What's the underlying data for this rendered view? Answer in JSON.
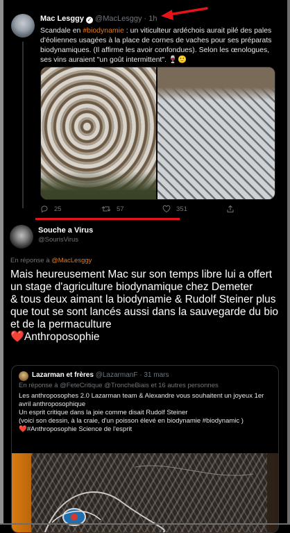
{
  "colors": {
    "accent": "#e07a19",
    "annotation_red": "#e6141a",
    "heart": "#e8245a"
  },
  "tweet1": {
    "name": "Mac Lesggy",
    "handle": "@MacLesggy",
    "time": "1h",
    "text_1": "Scandale en ",
    "hashtag": "#biodynamie",
    "text_2": " : un viticulteur ardéchois aurait pilé des pales d'éoliennes usagées à la place de cornes de vaches pour ses préparats biodynamiques.  (Il affirme les avoir confondues). Selon les œnologues, ses vins auraient \"un goût intermittent\". 🍷🙂",
    "replies": "25",
    "retweets": "57",
    "likes": "351"
  },
  "tweet2": {
    "name": "Souche a Virus",
    "handle": "@SourisVirus",
    "reply_prefix": "En réponse à ",
    "reply_to": "@MacLesggy",
    "text": "Mais heureusement Mac sur son temps libre lui a offert un stage d'agriculture biodynamique chez Demeter\n& tous deux aimant la biodynamie & Rudolf Steiner plus que tout se sont lancés aussi dans la sauvegarde du bio et de la permaculture",
    "heart": "❤️",
    "tag_line": "Anthroposophie"
  },
  "quote": {
    "name": "Lazarman et frères",
    "handle": "@LazarmanF",
    "date": "· 31 mars",
    "reply_line": "En réponse à @FeteCritique @TroncheBiais et 16 autres personnes",
    "text": "Les anthroposophes 2.0 Lazarman team & Alexandre vous souhaitent un joyeux 1er avril anthroposophique\nUn esprit critique dans la joie comme disait Rudolf Steiner\n  (voici son dessin, à la craie, d'un poisson élevé en biodynamie #biodynamic )",
    "heart": "❤️",
    "tag_line": "#Anthroposophie Science de l'esprit"
  }
}
